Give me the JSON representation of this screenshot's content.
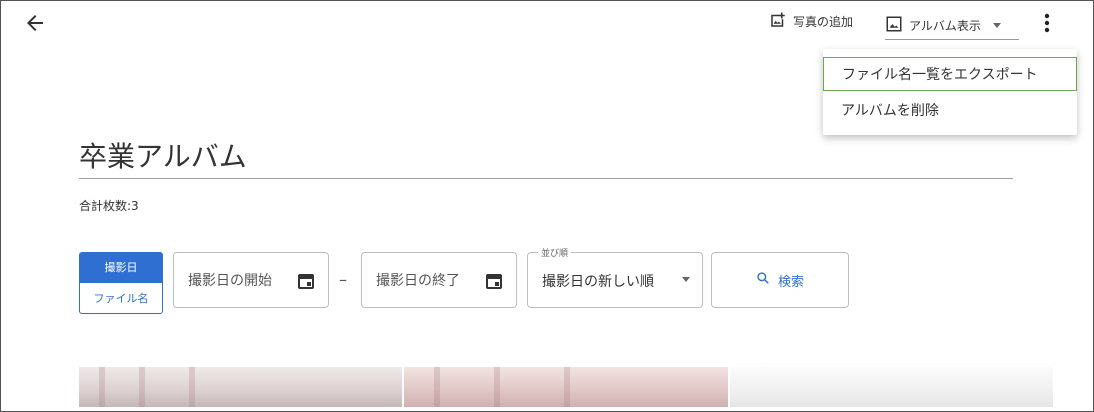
{
  "header": {
    "add_photo_label": "写真の追加",
    "view_label": "アルバム表示"
  },
  "menu": {
    "items": [
      {
        "label": "ファイル名一覧をエクスポート"
      },
      {
        "label": "アルバムを削除"
      }
    ],
    "selected_index": 0
  },
  "album": {
    "title": "卒業アルバム",
    "total_count": "合計枚数:3"
  },
  "filters": {
    "toggle": {
      "active_label": "撮影日",
      "inactive_label": "ファイル名"
    },
    "date_start_placeholder": "撮影日の開始",
    "date_end_placeholder": "撮影日の終了",
    "range_separator": "–",
    "sort": {
      "label": "並び順",
      "value": "撮影日の新しい順"
    },
    "search_label": "検索"
  },
  "colors": {
    "accent": "#2f6fd1",
    "menu_selected_border": "#6aa84f"
  },
  "icons": [
    "back-arrow-icon",
    "add-photo-icon",
    "image-icon",
    "caret-down-icon",
    "more-vert-icon",
    "calendar-icon",
    "search-icon"
  ]
}
